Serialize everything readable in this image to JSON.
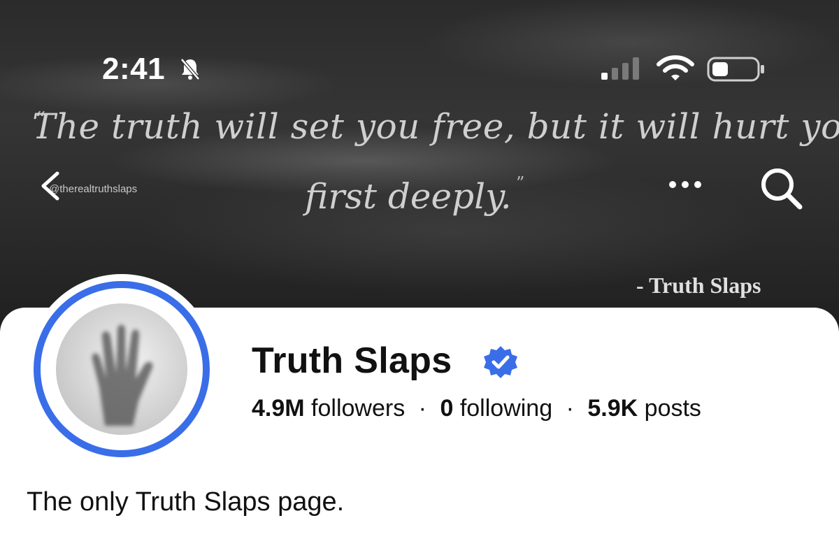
{
  "status_bar": {
    "time": "2:41",
    "bell_icon": "bell-slash-icon",
    "signal_icon": "signal-icon",
    "wifi_icon": "wifi-icon",
    "battery_icon": "battery-icon"
  },
  "cover": {
    "quote_line1": "The truth will set you free, but it will hurt you",
    "quote_line2": "first deeply.",
    "quote_open_mark": "“",
    "quote_close_mark": "”",
    "handle": "@therealtruthslaps",
    "attribution": "- Truth Slaps"
  },
  "nav": {
    "back_icon": "chevron-left-icon",
    "more_icon": "more-dots-icon",
    "search_icon": "search-icon"
  },
  "profile": {
    "name": "Truth Slaps",
    "verified_icon": "verified-badge-icon",
    "followers_count": "4.9M",
    "followers_label": "followers",
    "following_count": "0",
    "following_label": "following",
    "posts_count": "5.9K",
    "posts_label": "posts",
    "separator": "·",
    "bio": "The only Truth Slaps page."
  },
  "colors": {
    "accent_blue": "#3a6ee8",
    "text_primary": "#111111"
  }
}
